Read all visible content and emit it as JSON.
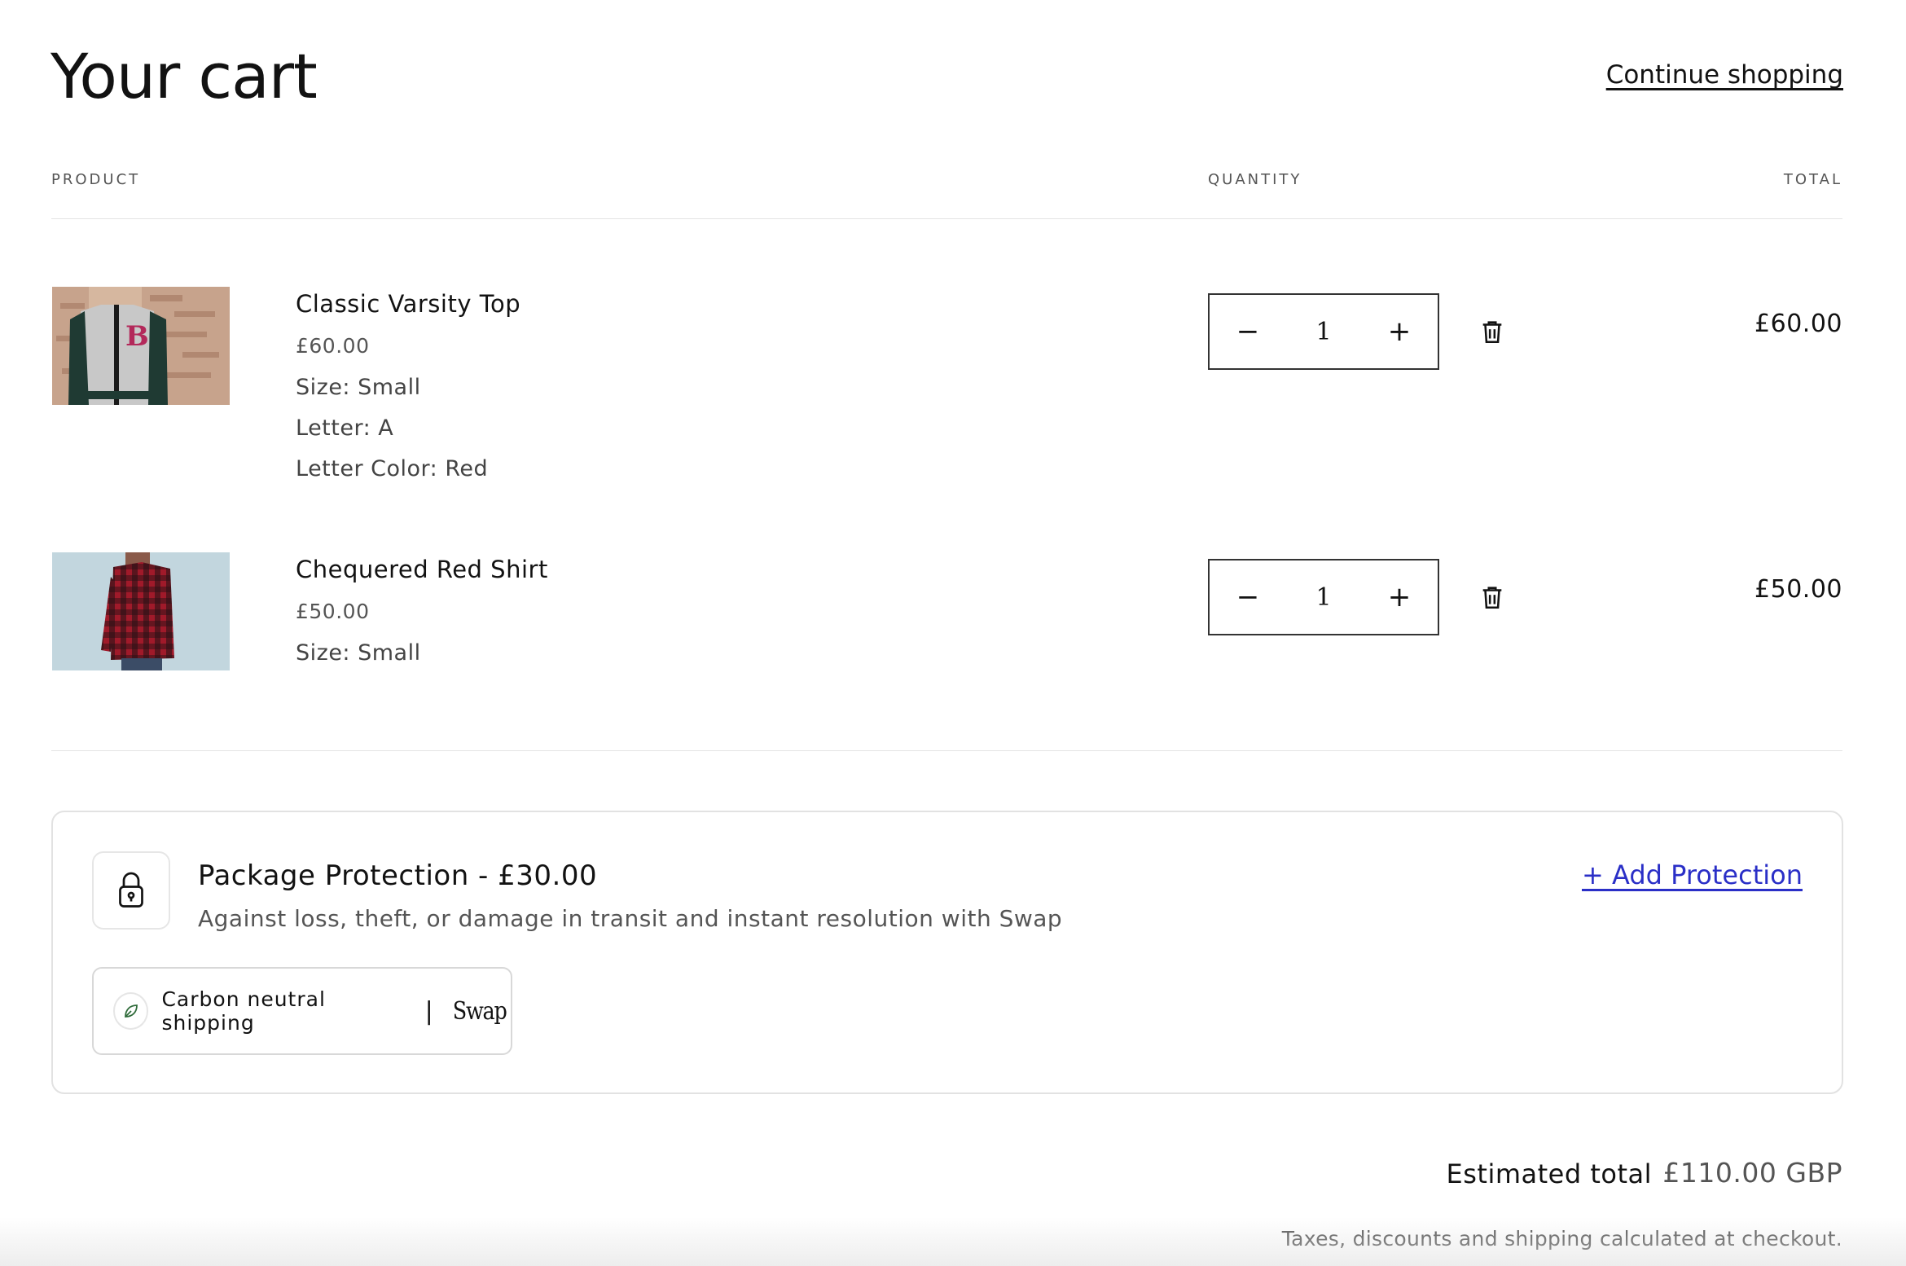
{
  "header": {
    "title": "Your cart",
    "continue_label": "Continue shopping"
  },
  "columns": {
    "product": "PRODUCT",
    "quantity": "QUANTITY",
    "total": "TOTAL"
  },
  "items": [
    {
      "name": "Classic Varsity Top",
      "price": "£60.00",
      "options": [
        "Size: Small",
        "Letter: A",
        "Letter Color: Red"
      ],
      "quantity": "1",
      "total": "£60.00"
    },
    {
      "name": "Chequered Red Shirt",
      "price": "£50.00",
      "options": [
        "Size: Small"
      ],
      "quantity": "1",
      "total": "£50.00"
    }
  ],
  "icons": {
    "minus": "−",
    "plus": "+"
  },
  "protection": {
    "title": "Package Protection - £30.00",
    "description": "Against loss, theft, or damage in transit and instant resolution with Swap",
    "add_label": "+ Add Protection",
    "carbon_label": "Carbon neutral shipping",
    "separator": "|",
    "brand": "Swap"
  },
  "summary": {
    "estimated_label": "Estimated total",
    "estimated_value": "£110.00 GBP",
    "note": "Taxes, discounts and shipping calculated at checkout."
  },
  "colors": {
    "accent_link": "#2a2fc7",
    "text": "#121212",
    "muted": "#555555"
  }
}
